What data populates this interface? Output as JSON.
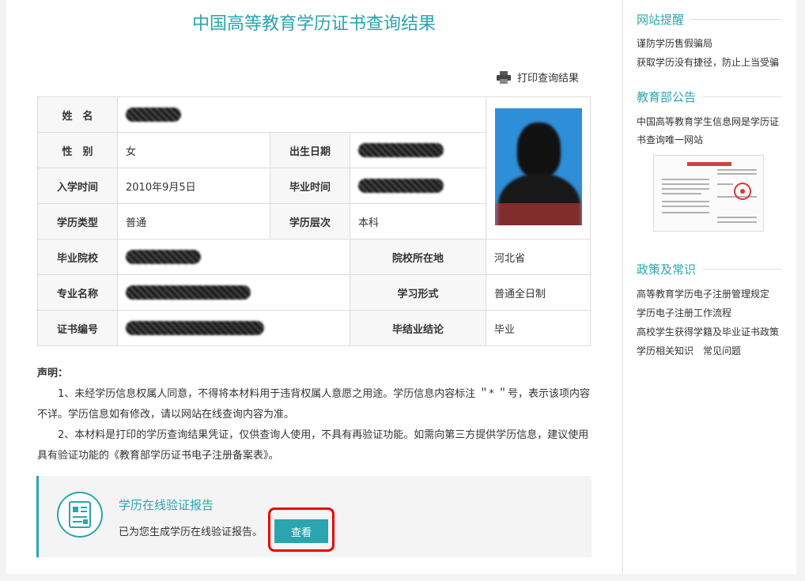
{
  "title": "中国高等教育学历证书查询结果",
  "print_label": "打印查询结果",
  "fields": {
    "name_label": "姓　名",
    "gender_label": "性　别",
    "gender": "女",
    "birth_label": "出生日期",
    "enroll_label": "入学时间",
    "enroll": "2010年9月5日",
    "grad_label": "毕业时间",
    "type_label": "学历类型",
    "type": "普通",
    "level_label": "学历层次",
    "level": "本科",
    "school_label": "毕业院校",
    "location_label": "院校所在地",
    "location": "河北省",
    "major_label": "专业名称",
    "form_label": "学习形式",
    "form": "普通全日制",
    "cert_label": "证书编号",
    "result_label": "毕结业结论",
    "result": "毕业"
  },
  "declaration": {
    "heading": "声明：",
    "p1": "1、未经学历信息权属人同意，不得将本材料用于违背权属人意愿之用途。学历信息内容标注 ＂* ＂号，表示该项内容不详。学历信息如有修改，请以网站在线查询内容为准。",
    "p2": "2、本材料是打印的学历查询结果凭证，仅供查询人使用，不具有再验证功能。如需向第三方提供学历信息，建议使用具有验证功能的《教育部学历证书电子注册备案表》。"
  },
  "report": {
    "title": "学历在线验证报告",
    "text": "已为您生成学历在线验证报告。",
    "button": "查看"
  },
  "sidebar": {
    "reminder_title": "网站提醒",
    "reminder_links": [
      "谨防学历售假骗局",
      "获取学历没有捷径，防止上当受骗"
    ],
    "notice_title": "教育部公告",
    "notice_links": [
      "中国高等教育学生信息网是学历证",
      "书查询唯一网站"
    ],
    "policy_title": "政策及常识",
    "policy_links": [
      "高等教育学历电子注册管理规定",
      "学历电子注册工作流程",
      "高校学生获得学籍及毕业证书政策"
    ],
    "policy_extra": [
      "学历相关知识",
      "常见问题"
    ]
  },
  "colors": {
    "accent": "#2aa5b0",
    "highlight": "#ee0000"
  }
}
